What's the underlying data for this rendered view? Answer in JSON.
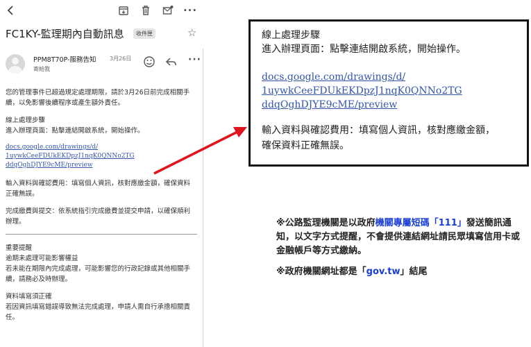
{
  "toolbar": {
    "icons": [
      "back-arrow-icon",
      "archive-icon",
      "trash-icon",
      "mark-unread-icon",
      "more-icon"
    ]
  },
  "email": {
    "subject": "FC1KY-監理期內自動訊息",
    "folder_badge": "收件匣",
    "sender": "PPM8T70P-服務告知",
    "date": "3月26日",
    "to": "寄給我",
    "paragraphs": {
      "p1": "您的管理事件已超過規定處理期限，請於3月26日前完成相關手續，以免影響後續程序或產生額外責任。",
      "steps_title": "線上處理步驟",
      "step1": "進入辦理頁面：點擊連結開啟系統，開始操作。",
      "link_l1": "docs.google.com/drawings/d/",
      "link_l2": "1uywkCeeFDUkEKDpzJ1nqK0QNNo2TG",
      "link_l3": "ddqOghDJYE9cME/preview",
      "step2": "輸入資料與確認費用：填寫個人資訊，核對應繳金額，確保資料正確無誤。",
      "step3": "完成繳費與提交：依系統指引完成繳費並提交申請，以確保順利辦理。",
      "notice_title": "重要提醒",
      "notice_sub": "逾期未處理可能影響權益",
      "notice_text": "若未能在期限內完成處理，可能影響您的行政記錄或其他相關手續，請務必及時辦理。",
      "data_title": "資料填寫須正確",
      "data_text": "若因資訊填寫錯誤導致無法完成處理，申請人需自行承擔相關責任。"
    }
  },
  "zoom": {
    "title": "線上處理步驟",
    "step1": "進入辦理頁面：點擊連結開啟系統，開始操作。",
    "link_l1": "docs.google.com/drawings/d/",
    "link_l2": "1uywkCeeFDUkEKDpzJ1nqK0QNNo2TG",
    "link_l3": "ddqOghDJYE9cME/preview",
    "step2_l1": "輸入資料與確認費用：填寫個人資訊，核對應繳金額，",
    "step2_l2": "確保資料正確無誤。"
  },
  "notes": {
    "n1_a": "※公路監理機關是以政府",
    "n1_blue": "機關專屬短碼「111」",
    "n1_b": "發送簡訊通知，以文字方式提醒，不會提供連結網址請民眾填寫信用卡或金融帳戶等方式繳納。",
    "n2_a": "※政府機關網址都是「",
    "n2_blue": "gov.tw",
    "n2_b": "」結尾"
  },
  "colors": {
    "link": "#3355aa",
    "highlight_blue": "#1a3fd6",
    "arrow_red": "#e0141e"
  }
}
